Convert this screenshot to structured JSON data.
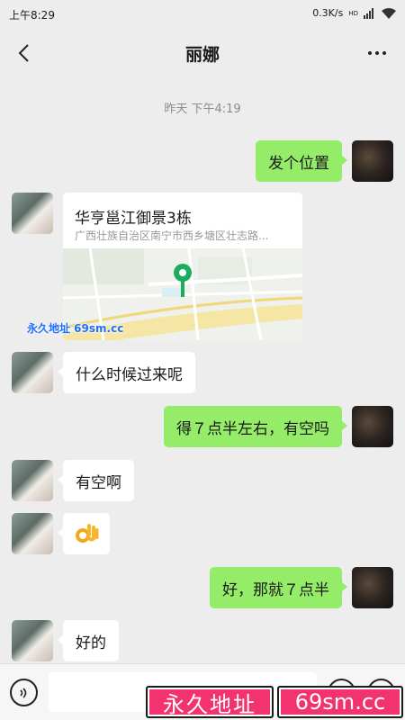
{
  "status_bar": {
    "time": "上午8:29",
    "speed": "0.3K/s",
    "network": "HD"
  },
  "nav": {
    "title": "丽娜"
  },
  "chat": {
    "timestamp": "昨天 下午4:19",
    "location": {
      "title": "华亨邕江御景3栋",
      "address": "广西壮族自治区南宁市西乡塘区壮志路..."
    },
    "messages": [
      {
        "side": "out",
        "text": "发个位置"
      },
      {
        "side": "in",
        "text": "什么时候过来呢"
      },
      {
        "side": "out",
        "text": "得７点半左右，有空吗"
      },
      {
        "side": "in",
        "text": "有空啊"
      },
      {
        "side": "out",
        "text": "好，那就７点半"
      },
      {
        "side": "in",
        "text": "好的"
      }
    ],
    "emoji": "OK hand"
  },
  "watermark": {
    "mid_text": "永久地址 69sm.cc"
  },
  "banner": {
    "left": "永久地址",
    "right": "69sm.cc"
  },
  "colors": {
    "background": "#ededed",
    "bubble_out": "#95ec69",
    "bubble_in": "#ffffff",
    "banner": "#f2336f",
    "map_pin": "#1aad5b"
  }
}
